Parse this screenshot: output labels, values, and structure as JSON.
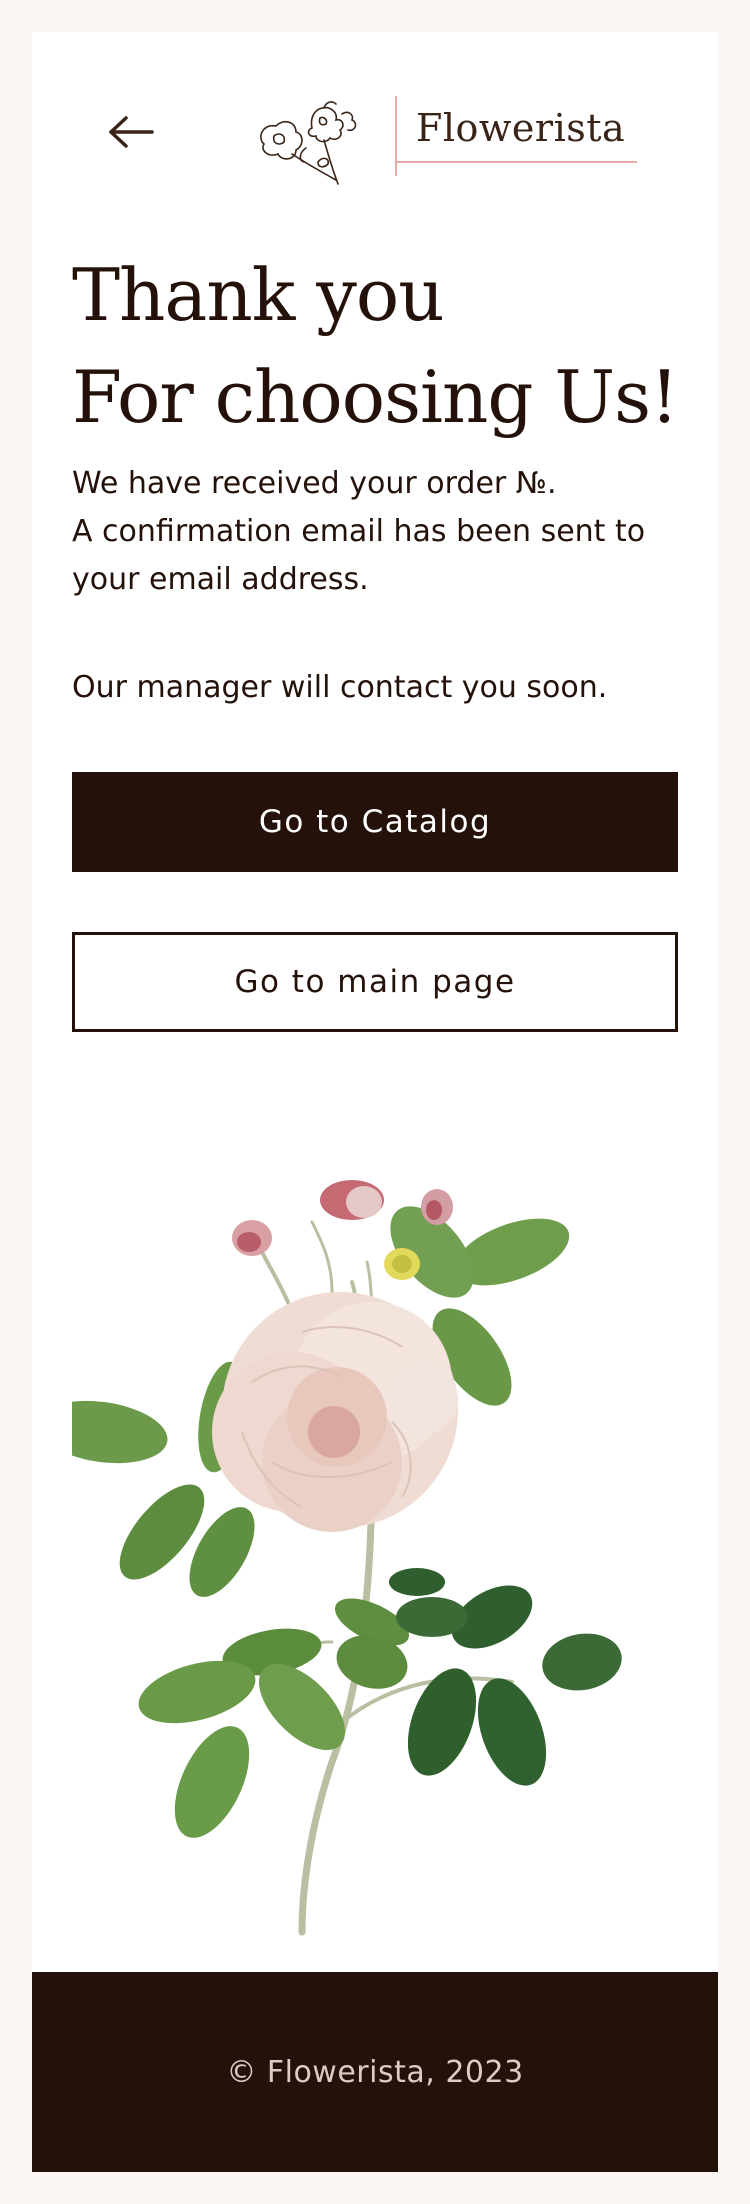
{
  "header": {
    "back_icon": "arrow-left-icon",
    "logo_icon": "flower-sketch-icon",
    "logo_text": "Flowerista"
  },
  "main": {
    "heading_line1": "Thank you",
    "heading_line2": "For choosing Us!",
    "message_line1": "We have received your order №.",
    "message_line2": "A confirmation email has been sent to your email address.",
    "message_line3": "Our manager will contact you soon.",
    "catalog_button": "Go to Catalog",
    "main_page_button": "Go to main page",
    "illustration_icon": "rose-illustration"
  },
  "footer": {
    "copyright": "© Flowerista, 2023"
  },
  "colors": {
    "page_bg": "#fbf6f1",
    "card_bg": "#ffffff",
    "dark_brown": "#24120a",
    "accent_pink": "#e6a9a3"
  }
}
